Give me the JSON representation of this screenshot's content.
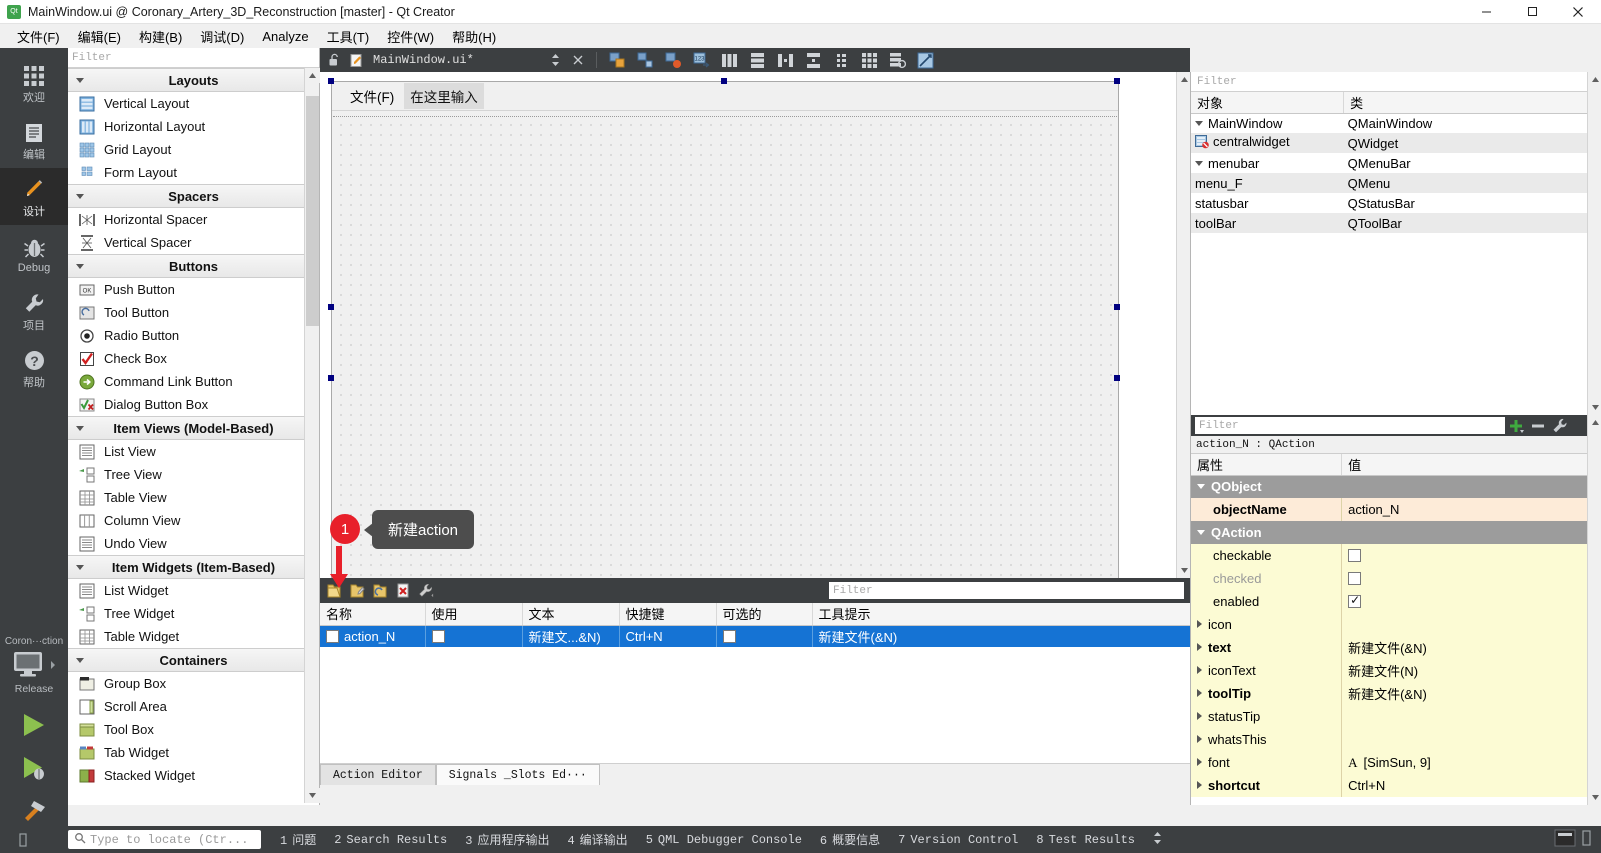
{
  "window": {
    "title": "MainWindow.ui @ Coronary_Artery_3D_Reconstruction [master] - Qt Creator",
    "app_icon": "qt-creator-icon",
    "buttons": {
      "minimize": "minimize-icon",
      "maximize": "maximize-icon",
      "close": "close-icon"
    }
  },
  "menubar": {
    "items": [
      {
        "label": "文件(F)",
        "mnemonic": "F"
      },
      {
        "label": "编辑(E)",
        "mnemonic": "E"
      },
      {
        "label": "构建(B)",
        "mnemonic": "B"
      },
      {
        "label": "调试(D)",
        "mnemonic": "D"
      },
      {
        "label": "Analyze",
        "mnemonic": "A"
      },
      {
        "label": "工具(T)",
        "mnemonic": "T"
      },
      {
        "label": "控件(W)",
        "mnemonic": "W"
      },
      {
        "label": "帮助(H)",
        "mnemonic": "H"
      }
    ]
  },
  "modebar": {
    "modes": [
      {
        "label": "欢迎",
        "icon": "grid-icon",
        "active": false
      },
      {
        "label": "编辑",
        "icon": "document-icon",
        "active": false
      },
      {
        "label": "设计",
        "icon": "pencil-icon",
        "active": true
      },
      {
        "label": "Debug",
        "icon": "bug-icon",
        "active": false
      },
      {
        "label": "项目",
        "icon": "wrench-icon",
        "active": false
      },
      {
        "label": "帮助",
        "icon": "question-icon",
        "active": false
      }
    ],
    "kit": {
      "project": "Coron···ction",
      "build_config": "Release",
      "icon": "monitor-icon",
      "run_button": "run-icon",
      "debug_button": "debug-icon",
      "build_button": "hammer-icon"
    }
  },
  "widgetbox": {
    "filter_placeholder": "Filter",
    "groups": [
      {
        "title": "Layouts",
        "items": [
          {
            "label": "Vertical Layout",
            "icon": "vertical-layout-icon"
          },
          {
            "label": "Horizontal Layout",
            "icon": "horizontal-layout-icon"
          },
          {
            "label": "Grid Layout",
            "icon": "grid-layout-icon"
          },
          {
            "label": "Form Layout",
            "icon": "form-layout-icon"
          }
        ]
      },
      {
        "title": "Spacers",
        "items": [
          {
            "label": "Horizontal Spacer",
            "icon": "horizontal-spacer-icon"
          },
          {
            "label": "Vertical Spacer",
            "icon": "vertical-spacer-icon"
          }
        ]
      },
      {
        "title": "Buttons",
        "items": [
          {
            "label": "Push Button",
            "icon": "push-button-icon"
          },
          {
            "label": "Tool Button",
            "icon": "tool-button-icon"
          },
          {
            "label": "Radio Button",
            "icon": "radio-button-icon"
          },
          {
            "label": "Check Box",
            "icon": "check-box-icon"
          },
          {
            "label": "Command Link Button",
            "icon": "command-link-icon"
          },
          {
            "label": "Dialog Button Box",
            "icon": "dialog-button-box-icon"
          }
        ]
      },
      {
        "title": "Item Views (Model-Based)",
        "items": [
          {
            "label": "List View",
            "icon": "list-view-icon"
          },
          {
            "label": "Tree View",
            "icon": "tree-view-icon"
          },
          {
            "label": "Table View",
            "icon": "table-view-icon"
          },
          {
            "label": "Column View",
            "icon": "column-view-icon"
          },
          {
            "label": "Undo View",
            "icon": "undo-view-icon"
          }
        ]
      },
      {
        "title": "Item Widgets (Item-Based)",
        "items": [
          {
            "label": "List Widget",
            "icon": "list-widget-icon"
          },
          {
            "label": "Tree Widget",
            "icon": "tree-widget-icon"
          },
          {
            "label": "Table Widget",
            "icon": "table-widget-icon"
          }
        ]
      },
      {
        "title": "Containers",
        "items": [
          {
            "label": "Group Box",
            "icon": "group-box-icon"
          },
          {
            "label": "Scroll Area",
            "icon": "scroll-area-icon"
          },
          {
            "label": "Tool Box",
            "icon": "tool-box-icon"
          },
          {
            "label": "Tab Widget",
            "icon": "tab-widget-icon"
          },
          {
            "label": "Stacked Widget",
            "icon": "stacked-widget-icon"
          }
        ]
      }
    ]
  },
  "editor_tabs": {
    "lock_icon": "unlocked-icon",
    "file_icon": "ui-file-icon",
    "filename": "MainWindow.ui*",
    "split_icon": "updown-icon",
    "close_icon": "close-icon",
    "designer_tools": [
      "edit-widgets-icon",
      "edit-signals-slots-icon",
      "edit-buddies-icon",
      "edit-tab-order-icon",
      "layout-horizontally-icon",
      "layout-vertically-icon",
      "layout-splitter-horizontal-icon",
      "layout-splitter-vertical-icon",
      "layout-form-icon",
      "layout-grid-icon",
      "break-layout-icon",
      "adjust-size-icon"
    ]
  },
  "designer": {
    "form_menubar": [
      {
        "label": "文件(F)",
        "type": "menu"
      },
      {
        "label": "在这里输入",
        "type": "placeholder"
      }
    ],
    "selected_object": "menubar"
  },
  "callout": {
    "number": "1",
    "text": "新建action",
    "badge_color": "#e8202a",
    "bubble_color": "#4d4d4d"
  },
  "action_editor": {
    "toolbar": [
      {
        "icon": "new-action-icon",
        "name": "new-action"
      },
      {
        "icon": "edit-action-icon",
        "name": "edit-action"
      },
      {
        "icon": "copy-action-icon",
        "name": "copy-action"
      },
      {
        "icon": "delete-action-icon",
        "name": "delete-action"
      },
      {
        "icon": "configure-icon",
        "name": "configure"
      }
    ],
    "filter_placeholder": "Filter",
    "columns": [
      "名称",
      "使用",
      "文本",
      "快捷键",
      "可选的",
      "工具提示"
    ],
    "rows": [
      {
        "name": "action_N",
        "used": false,
        "text": "新建文...&N)",
        "shortcut": "Ctrl+N",
        "checkable": false,
        "tooltip": "新建文件(&N)",
        "selected": true
      }
    ],
    "tabs": [
      {
        "label": "Action Editor",
        "active": true
      },
      {
        "label": "Signals _Slots Ed···",
        "active": false
      }
    ]
  },
  "object_inspector": {
    "filter_placeholder": "Filter",
    "columns": [
      "对象",
      "类"
    ],
    "rows": [
      {
        "object": "MainWindow",
        "class": "QMainWindow",
        "indent": 0,
        "expandable": true,
        "icon": ""
      },
      {
        "object": "centralwidget",
        "class": "QWidget",
        "indent": 2,
        "expandable": false,
        "icon": "no-layout-icon"
      },
      {
        "object": "menubar",
        "class": "QMenuBar",
        "indent": 1,
        "expandable": true,
        "icon": ""
      },
      {
        "object": "menu_F",
        "class": "QMenu",
        "indent": 2,
        "expandable": false,
        "icon": ""
      },
      {
        "object": "statusbar",
        "class": "QStatusBar",
        "indent": 1,
        "expandable": false,
        "icon": ""
      },
      {
        "object": "toolBar",
        "class": "QToolBar",
        "indent": 1,
        "expandable": false,
        "icon": ""
      }
    ]
  },
  "property_editor": {
    "filter_placeholder": "Filter",
    "add_button": "add-icon",
    "remove_button": "remove-icon",
    "configure_button": "configure-icon",
    "subject": "action_N : QAction",
    "columns": [
      "属性",
      "值"
    ],
    "rows": [
      {
        "kind": "group",
        "name": "QObject"
      },
      {
        "kind": "prop",
        "name": "objectName",
        "value": "action_N",
        "bold": true,
        "style": "peach"
      },
      {
        "kind": "group",
        "name": "QAction"
      },
      {
        "kind": "prop",
        "name": "checkable",
        "value": "",
        "control": "checkbox",
        "checked": false,
        "style": "yellow"
      },
      {
        "kind": "prop",
        "name": "checked",
        "value": "",
        "control": "checkbox",
        "checked": false,
        "style": "yellow",
        "disabled": true
      },
      {
        "kind": "prop",
        "name": "enabled",
        "value": "",
        "control": "checkbox",
        "checked": true,
        "style": "yellow"
      },
      {
        "kind": "prop",
        "name": "icon",
        "value": "",
        "expandable": true,
        "style": "yellow"
      },
      {
        "kind": "prop",
        "name": "text",
        "value": "新建文件(&N)",
        "expandable": true,
        "bold": true,
        "style": "yellow"
      },
      {
        "kind": "prop",
        "name": "iconText",
        "value": "新建文件(N)",
        "expandable": true,
        "style": "yellow"
      },
      {
        "kind": "prop",
        "name": "toolTip",
        "value": "新建文件(&N)",
        "expandable": true,
        "bold": true,
        "style": "yellow"
      },
      {
        "kind": "prop",
        "name": "statusTip",
        "value": "",
        "expandable": true,
        "style": "yellow"
      },
      {
        "kind": "prop",
        "name": "whatsThis",
        "value": "",
        "expandable": true,
        "style": "yellow"
      },
      {
        "kind": "prop",
        "name": "font",
        "value": "[SimSun, 9]",
        "expandable": true,
        "prefix": "A",
        "style": "yellow"
      },
      {
        "kind": "prop",
        "name": "shortcut",
        "value": "Ctrl+N",
        "expandable": true,
        "bold": true,
        "style": "yellow"
      }
    ]
  },
  "statusbar": {
    "locator_placeholder": "Type to locate (Ctr...",
    "search_icon": "search-icon",
    "panes": [
      {
        "num": "1",
        "label": "问题"
      },
      {
        "num": "2",
        "label": "Search Results"
      },
      {
        "num": "3",
        "label": "应用程序输出"
      },
      {
        "num": "4",
        "label": "编译输出"
      },
      {
        "num": "5",
        "label": "QML Debugger Console"
      },
      {
        "num": "6",
        "label": "概要信息"
      },
      {
        "num": "7",
        "label": "Version Control"
      },
      {
        "num": "8",
        "label": "Test Results"
      }
    ],
    "updown_icon": "updown-icon"
  },
  "colors": {
    "dark_chrome": "#3c3f41",
    "selection_blue": "#1573d4",
    "accent_red": "#e8202a",
    "property_yellow": "#fcfbd4",
    "property_peach": "#fdebd8"
  }
}
